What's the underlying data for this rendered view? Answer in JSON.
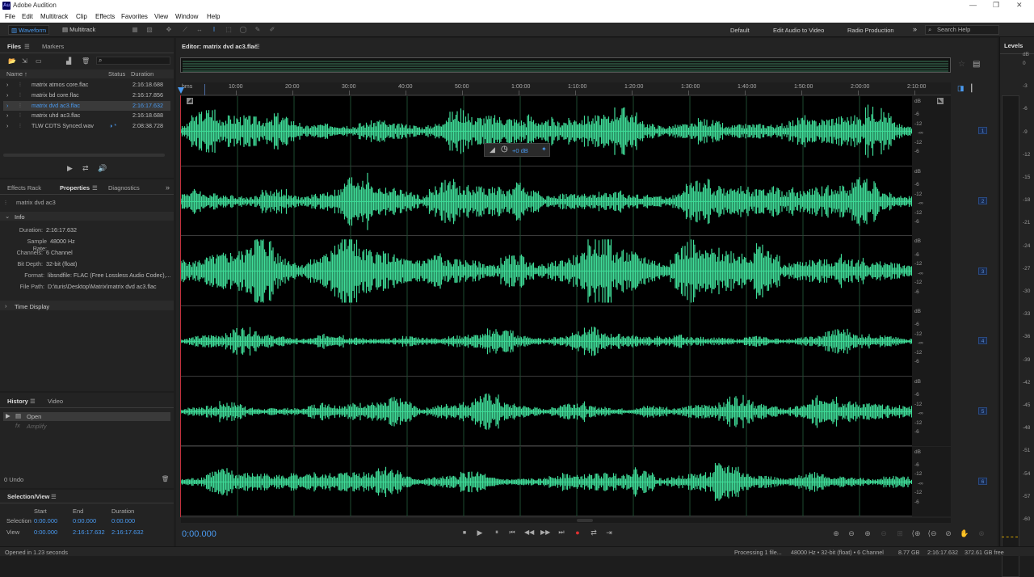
{
  "app": {
    "title": "Adobe Audition",
    "icon": "Au"
  },
  "menu": [
    "File",
    "Edit",
    "Multitrack",
    "Clip",
    "Effects",
    "Favorites",
    "View",
    "Window",
    "Help"
  ],
  "toolbar": {
    "waveform_label": "Waveform",
    "multitrack_label": "Multitrack",
    "workspaces": [
      "Default",
      "Edit Audio to Video",
      "Radio Production"
    ],
    "search_placeholder": "Search Help"
  },
  "files_panel": {
    "tabs": [
      "Files",
      "Markers"
    ],
    "columns": [
      "Name",
      "Status",
      "Duration"
    ],
    "rows": [
      {
        "name": "matrix atmos core.flac",
        "status": "",
        "duration": "2:16:18.688"
      },
      {
        "name": "matrix bd core.flac",
        "status": "",
        "duration": "2:16:17.856"
      },
      {
        "name": "matrix dvd ac3.flac",
        "status": "",
        "duration": "2:16:17.632"
      },
      {
        "name": "matrix uhd ac3.flac",
        "status": "",
        "duration": "2:16:18.688"
      },
      {
        "name": "TLW CDTS Synced.wav",
        "status": "◑ *",
        "duration": "2:08:38.728"
      }
    ],
    "selected_index": 2
  },
  "properties_panel": {
    "tabs": [
      "Effects Rack",
      "Properties",
      "Diagnostics"
    ],
    "file_name": "matrix dvd ac3",
    "info_title": "Info",
    "fields": [
      {
        "label": "Duration:",
        "value": "2:16:17.632"
      },
      {
        "label": "Sample Rate:",
        "value": "48000 Hz"
      },
      {
        "label": "Channels:",
        "value": "6 Channel"
      },
      {
        "label": "Bit Depth:",
        "value": "32-bit (float)"
      },
      {
        "label": "Format:",
        "value": "libsndfile: FLAC (Free Lossless Audio Codec),..."
      },
      {
        "label": "File Path:",
        "value": "D:\\turis\\Desktop\\Matrix\\matrix dvd ac3.flac"
      }
    ],
    "time_display": "Time Display"
  },
  "history_panel": {
    "tabs": [
      "History",
      "Video"
    ],
    "items": [
      "Open",
      "Amplify"
    ],
    "undo_count": "0 Undo"
  },
  "selection_view": {
    "title": "Selection/View",
    "columns": [
      "Start",
      "End",
      "Duration"
    ],
    "rows": [
      {
        "label": "Selection",
        "start": "0:00.000",
        "end": "0:00.000",
        "duration": "0:00.000"
      },
      {
        "label": "View",
        "start": "0:00.000",
        "end": "2:16:17.632",
        "duration": "2:16:17.632"
      }
    ]
  },
  "editor": {
    "title": "Editor: matrix dvd ac3.flac",
    "ruler_unit": "hms",
    "ruler_ticks": [
      "10:00",
      "20:00",
      "30:00",
      "40:00",
      "50:00",
      "1:00:00",
      "1:10:00",
      "1:20:00",
      "1:30:00",
      "1:40:00",
      "1:50:00",
      "2:00:00",
      "2:10:00"
    ],
    "hud_gain": "+0 dB",
    "db_unit": "dB",
    "db_labels": [
      "-6",
      "-12",
      "-∞",
      "-12",
      "-6"
    ],
    "channels": [
      "1",
      "2",
      "3",
      "4",
      "5",
      "6"
    ],
    "current_time": "0:00.000",
    "waveform_color": "#3fdc98"
  },
  "levels": {
    "title": "Levels",
    "scale": [
      "dB",
      "0",
      "-3",
      "-6",
      "-9",
      "-12",
      "-15",
      "-18",
      "-21",
      "-24",
      "-27",
      "-30",
      "-33",
      "-36",
      "-39",
      "-42",
      "-45",
      "-48",
      "-51",
      "-54",
      "-57",
      "-60"
    ]
  },
  "status": {
    "left": "Opened in 1.23 seconds",
    "processing": "Processing 1 file...",
    "format": "48000 Hz • 32-bit (float) • 6 Channel",
    "size": "8.77 GB",
    "duration": "2:16:17.632",
    "free": "372.61 GB free"
  }
}
